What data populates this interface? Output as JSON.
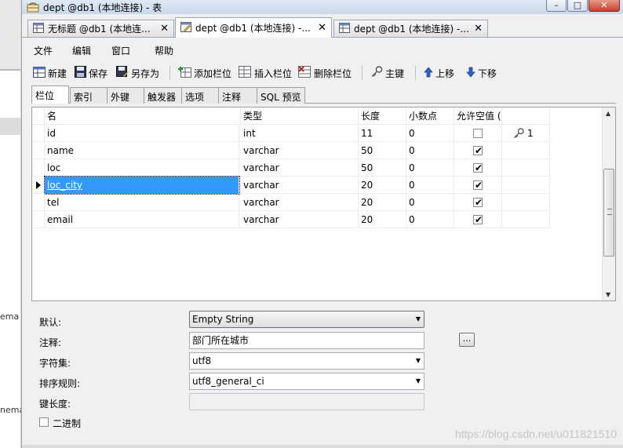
{
  "left_panel": {
    "fragments": [
      "ema",
      "nema"
    ]
  },
  "window": {
    "title": "dept @db1 (本地连接) - 表",
    "controls": {
      "minimize": "–",
      "maximize": "□",
      "close": "✕"
    }
  },
  "doc_tabs": [
    {
      "label": "无标题 @db1 (本地连...",
      "close": "✕"
    },
    {
      "label": "dept @db1 (本地连接) -...",
      "close": "✕"
    },
    {
      "label": "dept @db1 (本地连接) -...",
      "close": "✕"
    }
  ],
  "menu": [
    "文件",
    "编辑",
    "窗口",
    "帮助"
  ],
  "toolbar": {
    "new": "新建",
    "save": "保存",
    "save_as": "另存为",
    "add_column": "添加栏位",
    "insert_column": "插入栏位",
    "delete_column": "删除栏位",
    "primary_key": "主键",
    "move_up": "上移",
    "move_down": "下移"
  },
  "sub_tabs": [
    "栏位",
    "索引",
    "外键",
    "触发器",
    "选项",
    "注释",
    "SQL 预览"
  ],
  "grid": {
    "columns": [
      "名",
      "类型",
      "长度",
      "小数点",
      "允许空值 (",
      ""
    ],
    "rows": [
      {
        "name": "id",
        "type": "int",
        "length": "11",
        "decimals": "0",
        "nullable": false,
        "key": "1"
      },
      {
        "name": "name",
        "type": "varchar",
        "length": "50",
        "decimals": "0",
        "nullable": true,
        "key": ""
      },
      {
        "name": "loc",
        "type": "varchar",
        "length": "50",
        "decimals": "0",
        "nullable": true,
        "key": ""
      },
      {
        "name": "loc_city",
        "type": "varchar",
        "length": "20",
        "decimals": "0",
        "nullable": true,
        "key": ""
      },
      {
        "name": "tel",
        "type": "varchar",
        "length": "20",
        "decimals": "0",
        "nullable": true,
        "key": ""
      },
      {
        "name": "email",
        "type": "varchar",
        "length": "20",
        "decimals": "0",
        "nullable": true,
        "key": ""
      }
    ],
    "check_mark": "✔"
  },
  "properties": {
    "default_label": "默认:",
    "default_value": "Empty String",
    "comment_label": "注释:",
    "comment_value": "部门所在城市",
    "ellipsis": "...",
    "charset_label": "字符集:",
    "charset_value": "utf8",
    "collation_label": "排序规则:",
    "collation_value": "utf8_general_ci",
    "key_length_label": "键长度:",
    "key_length_value": "",
    "binary_label": "二进制"
  },
  "watermark": "https://blog.csdn.net/u011821510"
}
